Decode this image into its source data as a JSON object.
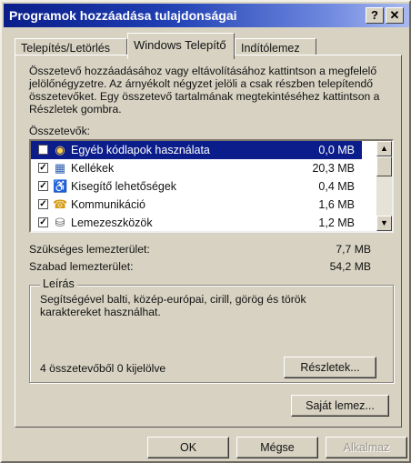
{
  "window": {
    "title": "Programok hozzáadása tulajdonságai",
    "help_label": "?",
    "close_label": "✕"
  },
  "tabs": [
    {
      "label": "Telepítés/Letörlés"
    },
    {
      "label": "Windows Telepítő"
    },
    {
      "label": "Indítólemez"
    }
  ],
  "panel": {
    "description": "Összetevő hozzáadásához vagy eltávolításához kattintson a megfelelő jelölőnégyzetre. Az árnyékolt négyzet jelöli a csak részben telepítendő összetevőket. Egy összetevő tartalmának megtekintéséhez kattintson a Részletek gombra.",
    "components_label": "Összetevők:",
    "components": [
      {
        "checked": false,
        "icon": "globe-icon",
        "name": "Egyéb kódlapok használata",
        "size": "0,0 MB",
        "selected": true
      },
      {
        "checked": true,
        "icon": "accessories-icon",
        "name": "Kellékek",
        "size": "20,3 MB",
        "selected": false
      },
      {
        "checked": true,
        "icon": "accessibility-icon",
        "name": "Kisegítő lehetőségek",
        "size": "0,4 MB",
        "selected": false
      },
      {
        "checked": true,
        "icon": "communication-icon",
        "name": "Kommunikáció",
        "size": "1,6 MB",
        "selected": false
      },
      {
        "checked": true,
        "icon": "disk-tools-icon",
        "name": "Lemezeszközök",
        "size": "1,2 MB",
        "selected": false
      }
    ],
    "required_label": "Szükséges lemezterület:",
    "required_value": "7,7 MB",
    "free_label": "Szabad lemezterület:",
    "free_value": "54,2 MB",
    "description_group_label": "Leírás",
    "description_text": "Segítségével balti, közép-európai, cirill, görög és török karaktereket használhat.",
    "selection_status": "4 összetevőből 0 kijelölve",
    "details_button": "Részletek...",
    "have_disk_button": "Saját lemez..."
  },
  "footer": {
    "ok_label": "OK",
    "cancel_label": "Mégse",
    "apply_label": "Alkalmaz"
  },
  "colors": {
    "title_bar": "#0a1e8a",
    "selection": "#0b1d8a",
    "face": "#d7d2c2"
  }
}
